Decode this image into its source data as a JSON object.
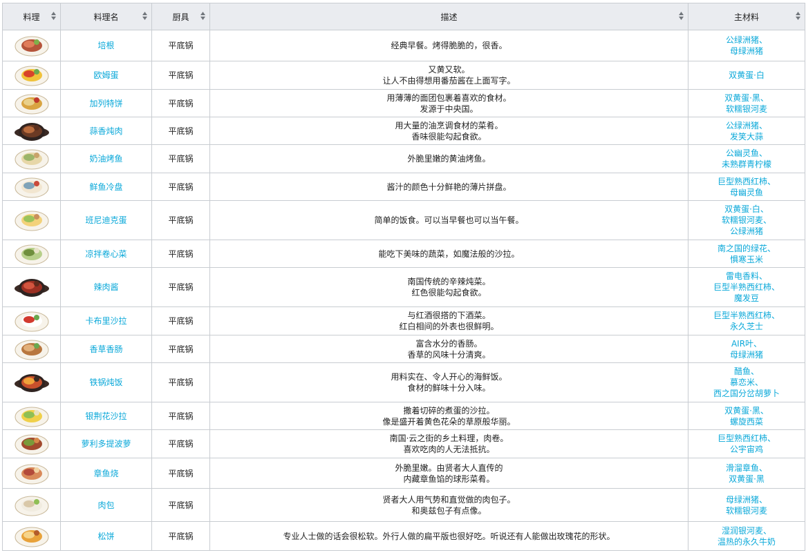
{
  "header": {
    "dish_image": "料理",
    "dish_name": "料理名",
    "tool": "厨具",
    "description": "描述",
    "ingredients": "主材料"
  },
  "sort_icon": "sort-updown-icon",
  "colors": {
    "link": "#0aa8d9",
    "header_bg": "#eaecf0",
    "border": "#c8ccd1"
  },
  "rows": [
    {
      "name": "培根",
      "tool": "平底锅",
      "desc": [
        "经典早餐。烤得脆脆的，很香。"
      ],
      "ingredients": [
        "公绿洲猪、",
        "母绿洲猪"
      ],
      "icon": "bacon-dish-icon"
    },
    {
      "name": "欧姆蛋",
      "tool": "平底锅",
      "desc": [
        "又黄又软。",
        "让人不由得想用番茄酱在上面写字。"
      ],
      "ingredients": [
        "双黄蛋·白"
      ],
      "icon": "omelette-dish-icon"
    },
    {
      "name": "加列特饼",
      "tool": "平底锅",
      "desc": [
        "用薄薄的面团包裹着喜欢的食材。",
        "发源于中央国。"
      ],
      "ingredients": [
        "双黄蛋·黑、",
        "软糯银河麦"
      ],
      "icon": "galette-dish-icon"
    },
    {
      "name": "蒜香炖肉",
      "tool": "平底锅",
      "desc": [
        "用大量的油烹调食材的菜肴。",
        "香味很能勾起食欲。"
      ],
      "ingredients": [
        "公绿洲猪、",
        "发笑大蒜"
      ],
      "icon": "garlic-stew-dish-icon"
    },
    {
      "name": "奶油烤鱼",
      "tool": "平底锅",
      "desc": [
        "外脆里嫩的黄油烤鱼。"
      ],
      "ingredients": [
        "公幽灵鱼、",
        "未熟群青柠檬"
      ],
      "icon": "butter-fish-dish-icon"
    },
    {
      "name": "鲜鱼冷盘",
      "tool": "平底锅",
      "desc": [
        "酱汁的颜色十分鲜艳的薄片拼盘。"
      ],
      "ingredients": [
        "巨型熟西红柿、",
        "母幽灵鱼"
      ],
      "icon": "carpaccio-dish-icon"
    },
    {
      "name": "班尼迪克蛋",
      "tool": "平底锅",
      "desc": [
        "简单的饭食。可以当早餐也可以当午餐。"
      ],
      "ingredients": [
        "双黄蛋·白、",
        "软糯银河麦、",
        "公绿洲猪"
      ],
      "icon": "eggs-benedict-dish-icon"
    },
    {
      "name": "凉拌卷心菜",
      "tool": "平底锅",
      "desc": [
        "能吃下美味的蔬菜，如魔法般的沙拉。"
      ],
      "ingredients": [
        "南之国的绿花、",
        "惧寒玉米"
      ],
      "icon": "coleslaw-dish-icon"
    },
    {
      "name": "辣肉酱",
      "tool": "平底锅",
      "desc": [
        "南国传统的辛辣炖菜。",
        "红色很能勾起食欲。"
      ],
      "ingredients": [
        "雷电香料、",
        "巨型半熟西红柿、",
        "魔发豆"
      ],
      "icon": "chili-con-carne-dish-icon"
    },
    {
      "name": "卡布里沙拉",
      "tool": "平底锅",
      "desc": [
        "与红酒很搭的下酒菜。",
        "红白相间的外表也很鲜明。"
      ],
      "ingredients": [
        "巨型半熟西红柿、",
        "永久芝士"
      ],
      "icon": "caprese-dish-icon"
    },
    {
      "name": "香草香肠",
      "tool": "平底锅",
      "desc": [
        "富含水分的香肠。",
        "香草的风味十分清爽。"
      ],
      "ingredients": [
        "AIR叶、",
        "母绿洲猪"
      ],
      "icon": "herb-sausage-dish-icon"
    },
    {
      "name": "铁锅炖饭",
      "tool": "平底锅",
      "desc": [
        "用料实在、令人开心的海鲜饭。",
        "食材的鲜味十分入味。"
      ],
      "ingredients": [
        "醋鱼、",
        "慕恋米、",
        "西之国分岔胡萝卜"
      ],
      "icon": "paella-dish-icon"
    },
    {
      "name": "银荆花沙拉",
      "tool": "平底锅",
      "desc": [
        "撒着切碎的煮蛋的沙拉。",
        "像是盛开着黄色花朵的草原般华丽。"
      ],
      "ingredients": [
        "双黄蛋·黑、",
        "螺旋西菜"
      ],
      "icon": "mimosa-salad-dish-icon"
    },
    {
      "name": "萝利多提波萝",
      "tool": "平底锅",
      "desc": [
        "南国·云之街的乡土料理，肉卷。",
        "喜欢吃肉的人无法抵抗。"
      ],
      "ingredients": [
        "巨型熟西红柿、",
        "公宇宙鸡"
      ],
      "icon": "meat-roll-dish-icon"
    },
    {
      "name": "章鱼烧",
      "tool": "平底锅",
      "desc": [
        "外脆里嫩。由贤者大人直传的",
        "内藏章鱼馅的球形菜肴。"
      ],
      "ingredients": [
        "滑溜章鱼、",
        "双黄蛋·黑"
      ],
      "icon": "takoyaki-dish-icon"
    },
    {
      "name": "肉包",
      "tool": "平底锅",
      "desc": [
        "贤者大人用气势和直觉做的肉包子。",
        "和奥兹包子有点像。"
      ],
      "ingredients": [
        "母绿洲猪、",
        "软糯银河麦"
      ],
      "icon": "meat-bun-dish-icon"
    },
    {
      "name": "松饼",
      "tool": "平底锅",
      "desc": [
        "专业人士做的话会很松软。外行人做的扁平版也很好吃。听说还有人能做出玫瑰花的形状。"
      ],
      "ingredients": [
        "湿润银河麦、",
        "温热的永久牛奶"
      ],
      "icon": "pancake-dish-icon"
    }
  ]
}
